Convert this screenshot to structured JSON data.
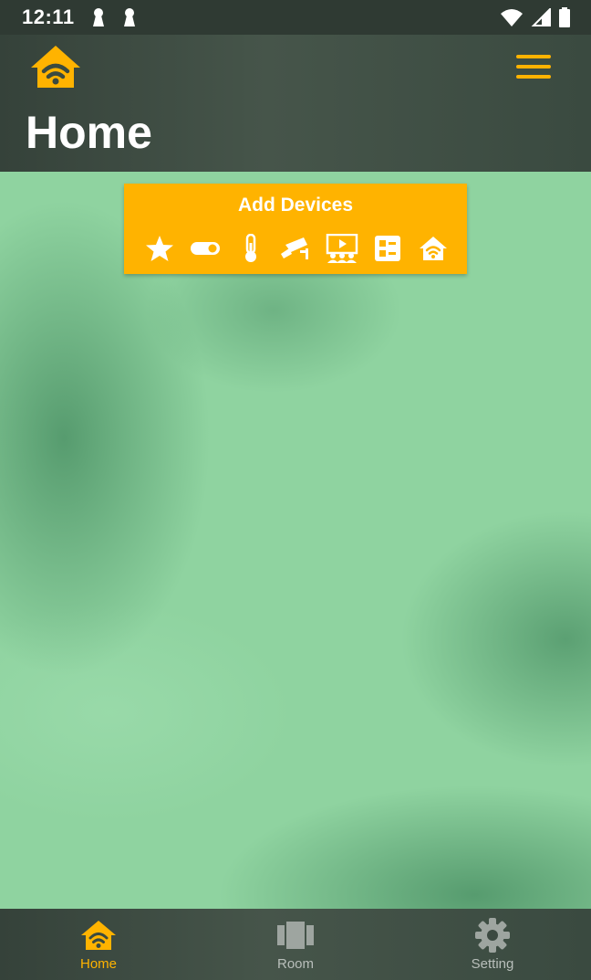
{
  "status_bar": {
    "time": "12:11"
  },
  "header": {
    "title": "Home"
  },
  "add_devices": {
    "title": "Add Devices",
    "icons": [
      "star-icon",
      "toggle-switch-icon",
      "thermometer-icon",
      "security-camera-icon",
      "media-player-icon",
      "control-panel-icon",
      "smart-home-icon"
    ]
  },
  "bottom_nav": {
    "items": [
      {
        "label": "Home",
        "icon": "home-wifi-icon",
        "active": true
      },
      {
        "label": "Room",
        "icon": "room-icon",
        "active": false
      },
      {
        "label": "Setting",
        "icon": "gear-icon",
        "active": false
      }
    ]
  },
  "colors": {
    "accent": "#ffb300",
    "bar_background": "#3c4a41",
    "page_background": "#8fd3a0",
    "inactive_nav": "#b9bfbb"
  }
}
